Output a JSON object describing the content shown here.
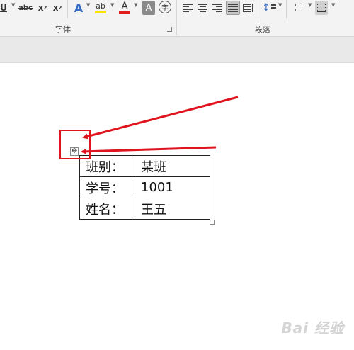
{
  "ribbon": {
    "font_group_label": "字体",
    "paragraph_group_label": "段落",
    "buttons": {
      "underline": "U",
      "strikethrough": "abc",
      "subscript_base": "x",
      "subscript_mark": "2",
      "superscript_base": "x",
      "superscript_mark": "2",
      "text_effects": "A",
      "highlight": "ab",
      "font_color": "A",
      "char_shading": "A",
      "enclose_char": "字"
    }
  },
  "table": {
    "rows": [
      {
        "label": "班别：",
        "value": "某班"
      },
      {
        "label": "学号：",
        "value": "1001"
      },
      {
        "label": "姓名：",
        "value": "王五"
      }
    ]
  },
  "move_handle_symbol": "✥",
  "watermark": "Bai 经验",
  "colors": {
    "annotation_red": "#e0141e",
    "highlight_yellow": "#f5e600",
    "font_color_red": "#e02020"
  }
}
